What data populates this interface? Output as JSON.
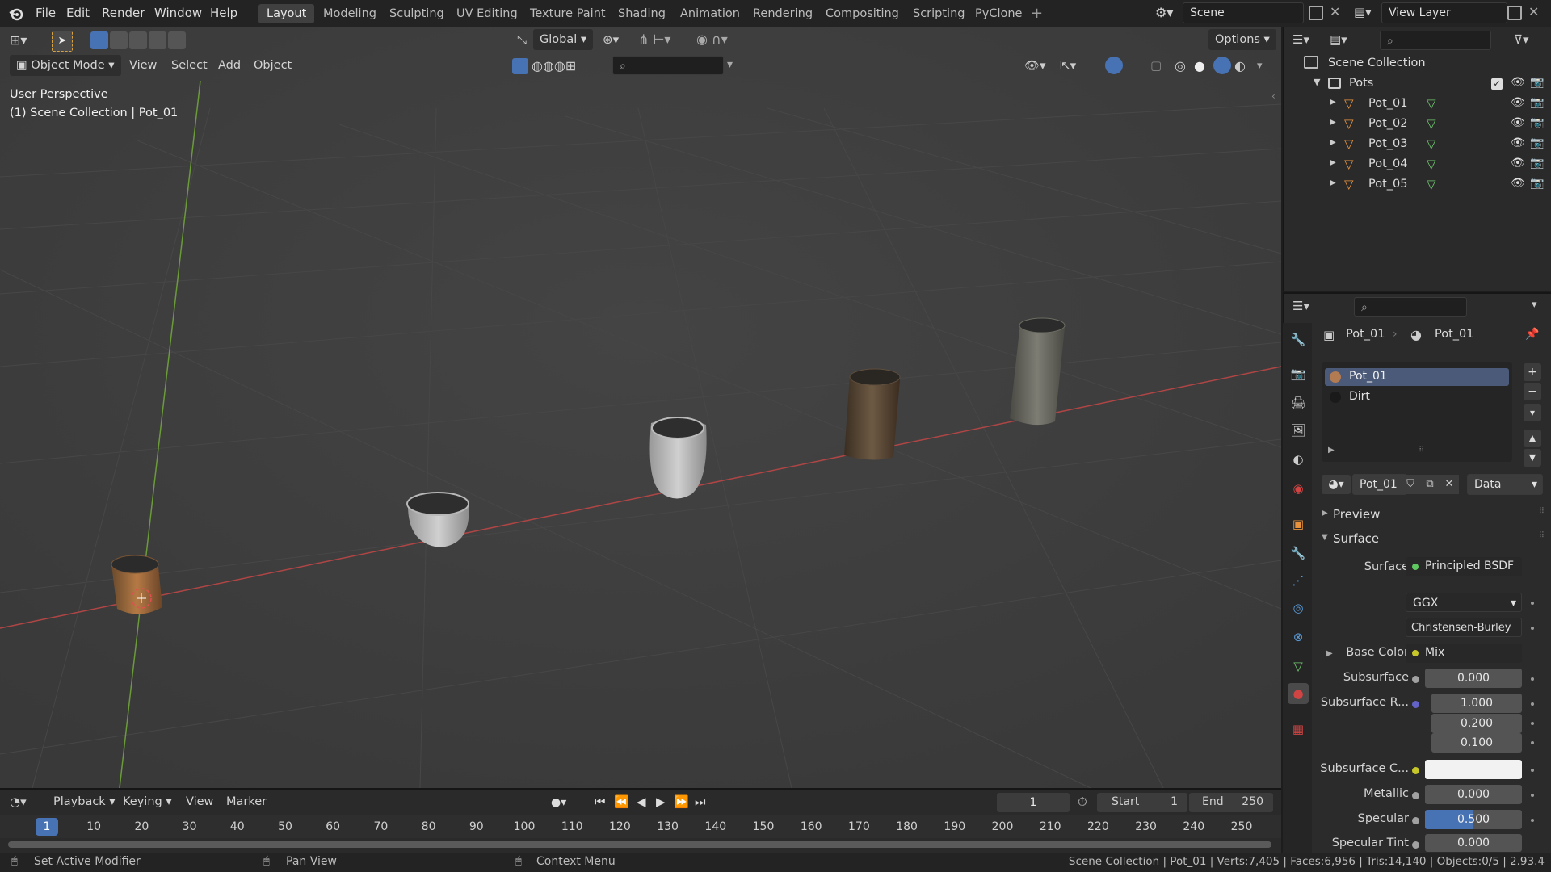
{
  "menubar": {
    "items": [
      "File",
      "Edit",
      "Render",
      "Window",
      "Help"
    ]
  },
  "workspaces": [
    "Layout",
    "Modeling",
    "Sculpting",
    "UV Editing",
    "Texture Paint",
    "Shading",
    "Animation",
    "Rendering",
    "Compositing",
    "Scripting",
    "PyClone"
  ],
  "active_workspace": "Layout",
  "scene": {
    "label": "Scene"
  },
  "view_layer": {
    "label": "View Layer"
  },
  "viewport": {
    "mode": "Object Mode",
    "menus": [
      "View",
      "Select",
      "Add",
      "Object"
    ],
    "orientation": "Global",
    "options_label": "Options",
    "overlay_title": "User Perspective",
    "overlay_subtitle": "(1) Scene Collection | Pot_01"
  },
  "outliner": {
    "root": "Scene Collection",
    "collection": "Pots",
    "objects": [
      "Pot_01",
      "Pot_02",
      "Pot_03",
      "Pot_04",
      "Pot_05"
    ]
  },
  "properties": {
    "breadcrumb_object": "Pot_01",
    "breadcrumb_material": "Pot_01",
    "material_slots": [
      "Pot_01",
      "Dirt"
    ],
    "material_name": "Pot_01",
    "link_mode": "Data",
    "panels": {
      "preview": "Preview",
      "surface": "Surface"
    },
    "surface_label": "Surface",
    "surface_shader": "Principled BSDF",
    "distribution": "GGX",
    "subsurface_method": "Christensen-Burley",
    "base_color_label": "Base Color",
    "base_color_value": "Mix",
    "subsurface_label": "Subsurface",
    "subsurface_value": "0.000",
    "subsurface_radius_label": "Subsurface R...",
    "subsurface_radius": [
      "1.000",
      "0.200",
      "0.100"
    ],
    "subsurface_color_label": "Subsurface C...",
    "metallic_label": "Metallic",
    "metallic_value": "0.000",
    "specular_label": "Specular",
    "specular_value": "0.500",
    "specular_fraction": 0.5,
    "specular_tint_label": "Specular Tint",
    "specular_tint_value": "0.000"
  },
  "timeline": {
    "menus": [
      "Playback",
      "Keying",
      "View",
      "Marker"
    ],
    "current_frame": "1",
    "start_label": "Start",
    "start": "1",
    "end_label": "End",
    "end": "250",
    "ruler": [
      "1",
      "10",
      "20",
      "30",
      "40",
      "50",
      "60",
      "70",
      "80",
      "90",
      "100",
      "110",
      "120",
      "130",
      "140",
      "150",
      "160",
      "170",
      "180",
      "190",
      "200",
      "210",
      "220",
      "230",
      "240",
      "250"
    ]
  },
  "statusbar": {
    "left": "Set Active Modifier",
    "middle": "Pan View",
    "right_hint": "Context Menu",
    "stats": "Scene Collection | Pot_01 | Verts:7,405 | Faces:6,956 | Tris:14,140 | Objects:0/5 | 2.93.4"
  },
  "colors": {
    "accent": "#4772b3",
    "active_tab": "#404040",
    "panel": "#2b2b2b"
  }
}
